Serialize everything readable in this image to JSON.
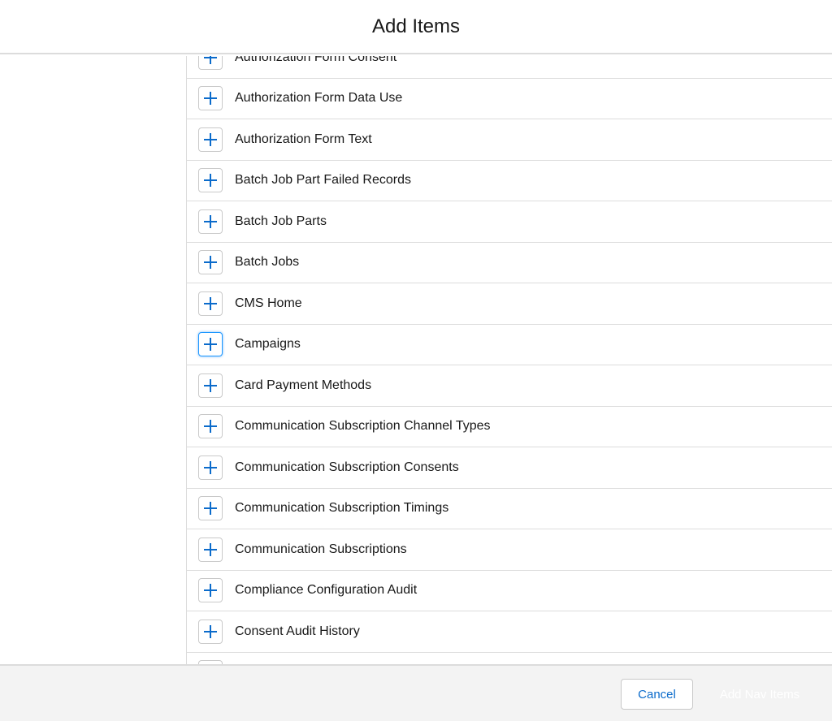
{
  "header": {
    "title": "Add Items"
  },
  "items": [
    {
      "label": "Authorization Form Consent"
    },
    {
      "label": "Authorization Form Data Use"
    },
    {
      "label": "Authorization Form Text"
    },
    {
      "label": "Batch Job Part Failed Records"
    },
    {
      "label": "Batch Job Parts"
    },
    {
      "label": "Batch Jobs"
    },
    {
      "label": "CMS Home"
    },
    {
      "label": "Campaigns",
      "focused": true
    },
    {
      "label": "Card Payment Methods"
    },
    {
      "label": "Communication Subscription Channel Types"
    },
    {
      "label": "Communication Subscription Consents"
    },
    {
      "label": "Communication Subscription Timings"
    },
    {
      "label": "Communication Subscriptions"
    },
    {
      "label": "Compliance Configuration Audit"
    },
    {
      "label": "Consent Audit History"
    }
  ],
  "footer": {
    "cancel_label": "Cancel",
    "add_label": "Add Nav Items"
  },
  "colors": {
    "accent": "#0b6bcb",
    "footer_bg": "#f3f3f3"
  }
}
